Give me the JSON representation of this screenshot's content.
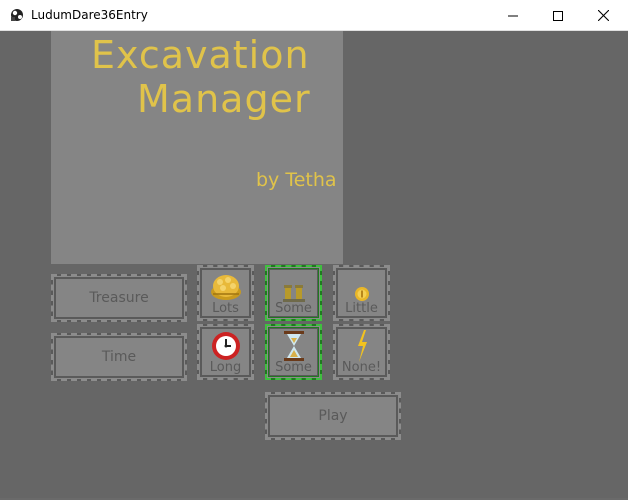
{
  "window": {
    "title": "LudumDare36Entry",
    "minimize_glyph": "minimize-icon",
    "maximize_glyph": "maximize-icon",
    "close_glyph": "close-icon"
  },
  "game": {
    "title_line1": "Excavation",
    "title_line2": "Manager",
    "byline": "by Tetha",
    "background": "#666666",
    "panel_color": "#858585",
    "title_color": "#e0c34a",
    "selected_border_color": "#3fbf3f"
  },
  "options": {
    "treasure_label": "Treasure",
    "time_label": "Time",
    "treasure_choices": [
      {
        "label": "Lots",
        "icon": "gold-pile-icon",
        "selected": false
      },
      {
        "label": "Some",
        "icon": "gold-bars-icon",
        "selected": true
      },
      {
        "label": "Little",
        "icon": "coin-icon",
        "selected": false
      }
    ],
    "time_choices": [
      {
        "label": "Long",
        "icon": "alarm-clock-icon",
        "selected": false
      },
      {
        "label": "Some",
        "icon": "hourglass-icon",
        "selected": true
      },
      {
        "label": "None!",
        "icon": "lightning-icon",
        "selected": false
      }
    ],
    "play_label": "Play"
  }
}
